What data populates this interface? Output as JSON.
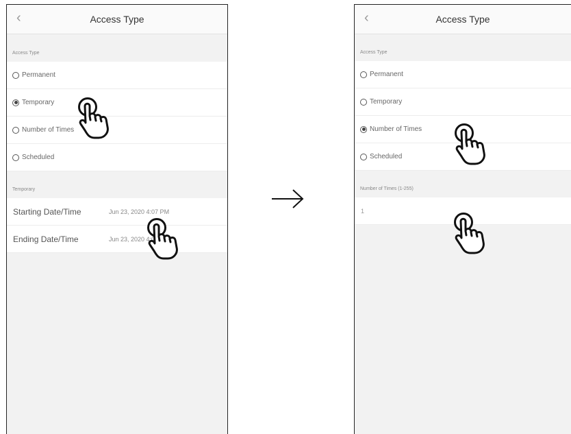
{
  "left_screen": {
    "header": {
      "back_icon": "chevron-left",
      "title": "Access Type"
    },
    "access_type_label": "Access Type",
    "options": [
      {
        "label": "Permanent",
        "selected": false
      },
      {
        "label": "Temporary",
        "selected": true
      },
      {
        "label": "Number of Times",
        "selected": false
      },
      {
        "label": "Scheduled",
        "selected": false
      }
    ],
    "temporary_label": "Temporary",
    "starting": {
      "label": "Starting Date/Time",
      "value": "Jun 23, 2020 4:07 PM"
    },
    "ending": {
      "label": "Ending Date/Time",
      "value": "Jun 23, 2020 4:07 PM"
    }
  },
  "right_screen": {
    "header": {
      "back_icon": "chevron-left",
      "title": "Access Type"
    },
    "access_type_label": "Access Type",
    "options": [
      {
        "label": "Permanent",
        "selected": false
      },
      {
        "label": "Temporary",
        "selected": false
      },
      {
        "label": "Number of Times",
        "selected": true
      },
      {
        "label": "Scheduled",
        "selected": false
      }
    ],
    "number_label": "Number of Times (1-255)",
    "number_value": "1"
  },
  "transition_icon": "right-arrow",
  "pointer_icon": "tap-hand"
}
